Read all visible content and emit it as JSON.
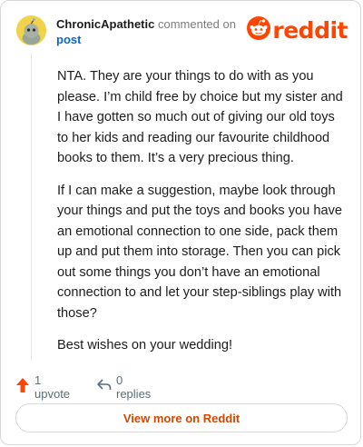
{
  "header": {
    "author": "ChronicApathetic",
    "action_text": "commented on",
    "post_link": "post",
    "logo_text": "reddit"
  },
  "body": {
    "paragraphs": [
      "NTA. They are your things to do with as you please. I’m child free by choice but my sister and I have gotten so much out of giving our old toys to her kids and reading our favourite childhood books to them. It’s a very precious thing.",
      "If I can make a suggestion, maybe look through your things and put the toys and books you have an emotional connection to one side, pack them up and put them into storage. Then you can pick out some things you don’t have an emotional connection to and let your step-siblings play with those?",
      "Best wishes on your wedding!"
    ]
  },
  "footer": {
    "upvote_label": "1 upvote",
    "replies_label": "0 replies",
    "view_more_label": "View more on Reddit"
  },
  "colors": {
    "brand": "#ff4500",
    "avatar_bg": "#f0d34a",
    "link": "#0a66c2"
  },
  "icons": [
    "avatar",
    "reddit-snoo-icon",
    "upvote-arrow-icon",
    "reply-icon"
  ]
}
